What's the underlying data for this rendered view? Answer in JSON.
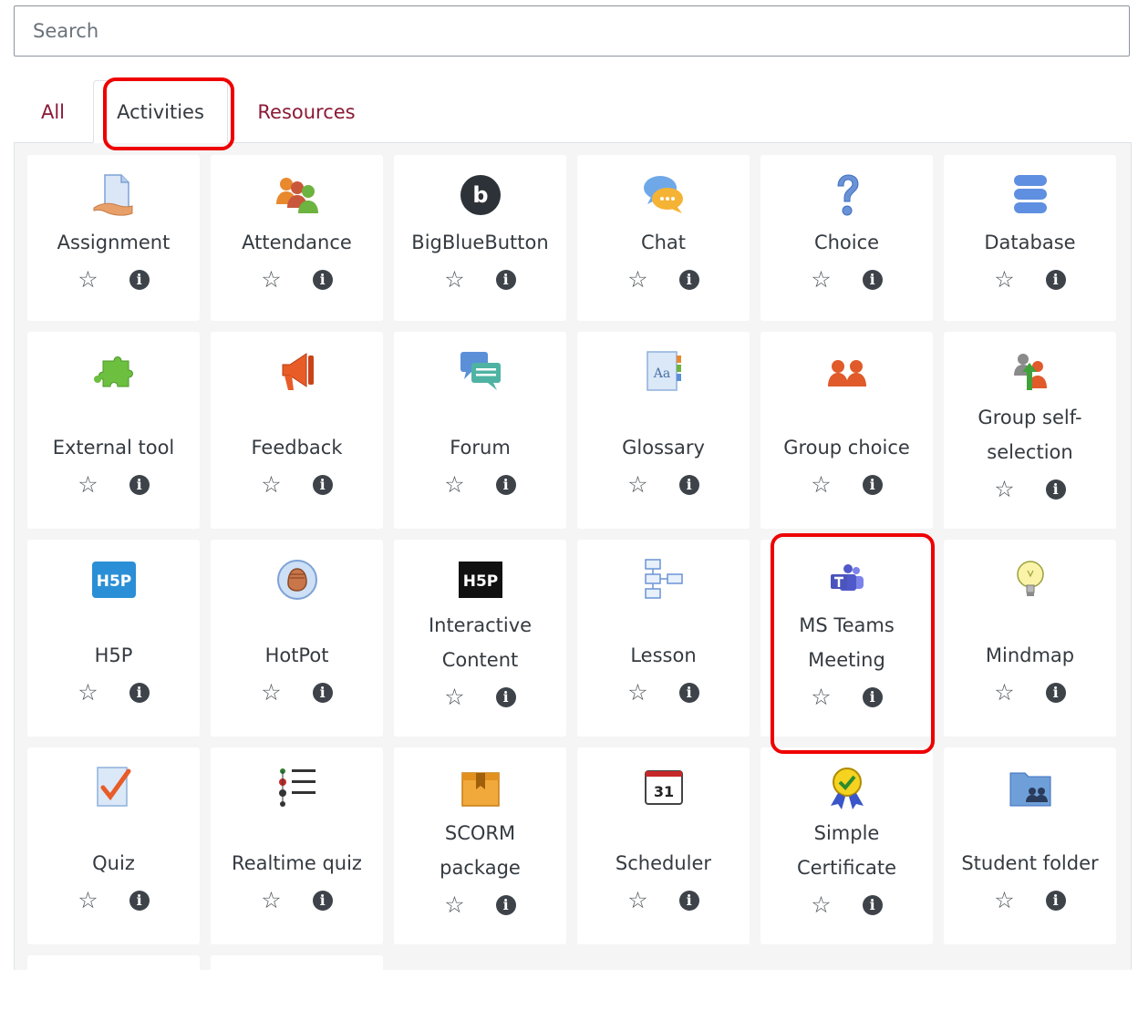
{
  "search": {
    "placeholder": "Search",
    "value": ""
  },
  "tabs": [
    {
      "label": "All",
      "active": false
    },
    {
      "label": "Activities",
      "active": true
    },
    {
      "label": "Resources",
      "active": false
    }
  ],
  "modules": [
    {
      "label": "Assignment",
      "icon": "assignment-icon"
    },
    {
      "label": "Attendance",
      "icon": "attendance-icon"
    },
    {
      "label": "BigBlueButton",
      "icon": "bigbluebutton-icon"
    },
    {
      "label": "Chat",
      "icon": "chat-icon"
    },
    {
      "label": "Choice",
      "icon": "choice-icon"
    },
    {
      "label": "Database",
      "icon": "database-icon"
    },
    {
      "label": "External tool",
      "icon": "external-tool-icon"
    },
    {
      "label": "Feedback",
      "icon": "feedback-icon"
    },
    {
      "label": "Forum",
      "icon": "forum-icon"
    },
    {
      "label": "Glossary",
      "icon": "glossary-icon"
    },
    {
      "label": "Group choice",
      "icon": "group-choice-icon"
    },
    {
      "label": "Group self-selection",
      "lines": [
        "Group self-",
        "selection"
      ],
      "icon": "group-self-selection-icon"
    },
    {
      "label": "H5P",
      "icon": "h5p-icon"
    },
    {
      "label": "HotPot",
      "icon": "hotpot-icon"
    },
    {
      "label": "Interactive Content",
      "lines": [
        "Interactive",
        "Content"
      ],
      "icon": "interactive-content-icon"
    },
    {
      "label": "Lesson",
      "icon": "lesson-icon"
    },
    {
      "label": "MS Teams Meeting",
      "lines": [
        "MS Teams",
        "Meeting"
      ],
      "icon": "ms-teams-icon"
    },
    {
      "label": "Mindmap",
      "icon": "mindmap-icon"
    },
    {
      "label": "Quiz",
      "icon": "quiz-icon"
    },
    {
      "label": "Realtime quiz",
      "icon": "realtime-quiz-icon"
    },
    {
      "label": "SCORM package",
      "lines": [
        "SCORM",
        "package"
      ],
      "icon": "scorm-icon"
    },
    {
      "label": "Scheduler",
      "icon": "scheduler-icon",
      "icon_text": "31"
    },
    {
      "label": "Simple Certificate",
      "lines": [
        "Simple",
        "Certificate"
      ],
      "icon": "certificate-icon"
    },
    {
      "label": "Student folder",
      "icon": "student-folder-icon"
    }
  ],
  "icons": {
    "star": "☆",
    "info": "i",
    "bigbluebutton_letter": "b",
    "h5p_text": "H5P"
  },
  "colors": {
    "link": "#8b1a36",
    "highlight": "#ee0000",
    "panel_bg": "#f5f5f5"
  }
}
